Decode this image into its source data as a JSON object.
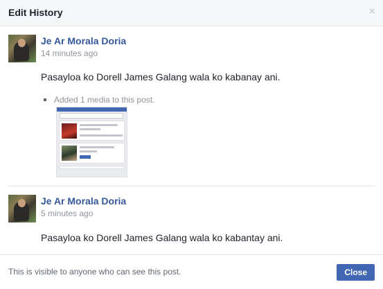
{
  "dialog": {
    "title": "Edit History",
    "close_symbol": "×",
    "close_icon": "close-icon"
  },
  "entries": [
    {
      "author": "Je Ar Morala Doria",
      "time": "14 minutes ago",
      "text": "Pasayloa ko Dorell James Galang wala ko kabanay ani.",
      "media_note": "Added 1 media to this post."
    },
    {
      "author": "Je Ar Morala Doria",
      "time": "5 minutes ago",
      "text": "Pasayloa ko Dorell James Galang wala ko kabantay ani."
    }
  ],
  "footer": {
    "visibility_text": "This is visible to anyone who can see this post.",
    "close_label": "Close"
  },
  "colors": {
    "accent": "#4267b2",
    "link": "#365899",
    "muted": "#90949c"
  }
}
